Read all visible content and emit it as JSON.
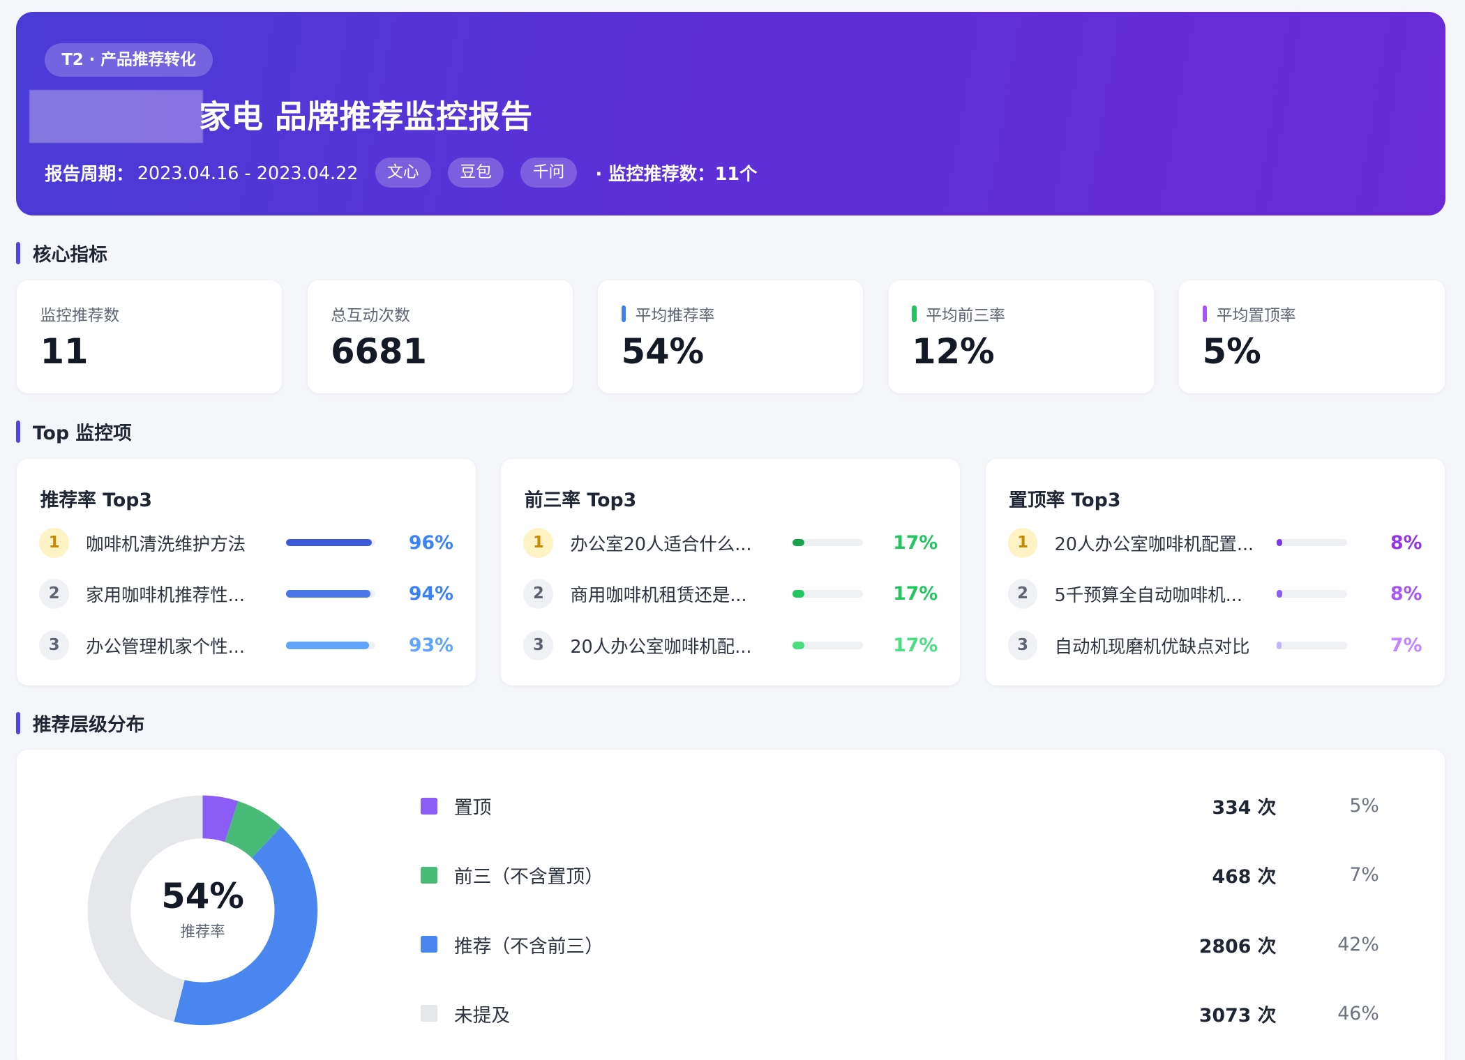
{
  "header": {
    "tag": "T2 · 产品推荐转化",
    "title": "家电 品牌推荐监控报告",
    "period_label": "报告周期：",
    "period_value": "2023.04.16 - 2023.04.22",
    "models": [
      "文心",
      "豆包",
      "千问"
    ],
    "monitor_count_text": "· 监控推荐数：11个"
  },
  "sections": {
    "core": "核心指标",
    "top": "Top 监控项",
    "dist": "推荐层级分布"
  },
  "kpis": [
    {
      "label": "监控推荐数",
      "value": "11",
      "accent": ""
    },
    {
      "label": "总互动次数",
      "value": "6681",
      "accent": ""
    },
    {
      "label": "平均推荐率",
      "value": "54%",
      "accent": "#3b82f6"
    },
    {
      "label": "平均前三率",
      "value": "12%",
      "accent": "#22c55e"
    },
    {
      "label": "平均置顶率",
      "value": "5%",
      "accent": "#a855f7"
    }
  ],
  "top_cards": [
    {
      "title": "推荐率 Top3",
      "items": [
        {
          "rank": "1",
          "name": "咖啡机清洗维护方法",
          "pct": "96%",
          "value": 0.96,
          "color": "#3b5bdb",
          "pct_color": "#3b82f6"
        },
        {
          "rank": "2",
          "name": "家用咖啡机推荐性...",
          "pct": "94%",
          "value": 0.94,
          "color": "#4a78e8",
          "pct_color": "#3b82f6"
        },
        {
          "rank": "3",
          "name": "办公管理机家个性...",
          "pct": "93%",
          "value": 0.93,
          "color": "#60a5fa",
          "pct_color": "#60a5fa"
        }
      ]
    },
    {
      "title": "前三率 Top3",
      "items": [
        {
          "rank": "1",
          "name": "办公室20人适合什么...",
          "pct": "17%",
          "value": 0.17,
          "color": "#16a34a",
          "pct_color": "#22c55e"
        },
        {
          "rank": "2",
          "name": "商用咖啡机租赁还是...",
          "pct": "17%",
          "value": 0.17,
          "color": "#22c55e",
          "pct_color": "#22c55e"
        },
        {
          "rank": "3",
          "name": "20人办公室咖啡机配...",
          "pct": "17%",
          "value": 0.17,
          "color": "#4ade80",
          "pct_color": "#4ade80"
        }
      ]
    },
    {
      "title": "置顶率 Top3",
      "items": [
        {
          "rank": "1",
          "name": "20人办公室咖啡机配置...",
          "pct": "8%",
          "value": 0.08,
          "color": "#7c3aed",
          "pct_color": "#9333ea"
        },
        {
          "rank": "2",
          "name": "5千预算全自动咖啡机...",
          "pct": "8%",
          "value": 0.08,
          "color": "#8b5cf6",
          "pct_color": "#a855f7"
        },
        {
          "rank": "3",
          "name": "自动机现磨机优缺点对比",
          "pct": "7%",
          "value": 0.07,
          "color": "#c4b5fd",
          "pct_color": "#c084fc"
        }
      ]
    }
  ],
  "distribution": {
    "center_value": "54%",
    "center_caption": "推荐率",
    "unit": "次",
    "rows": [
      {
        "label": "置顶",
        "count": "334 次",
        "pct": "5%",
        "value": 334,
        "color": "#8b5cf6"
      },
      {
        "label": "前三（不含置顶）",
        "count": "468 次",
        "pct": "7%",
        "value": 468,
        "color": "#48bb78"
      },
      {
        "label": "推荐（不含前三）",
        "count": "2806 次",
        "pct": "42%",
        "value": 2806,
        "color": "#4a86f0"
      },
      {
        "label": "未提及",
        "count": "3073 次",
        "pct": "46%",
        "value": 3073,
        "color": "#e5e7eb"
      }
    ]
  }
}
